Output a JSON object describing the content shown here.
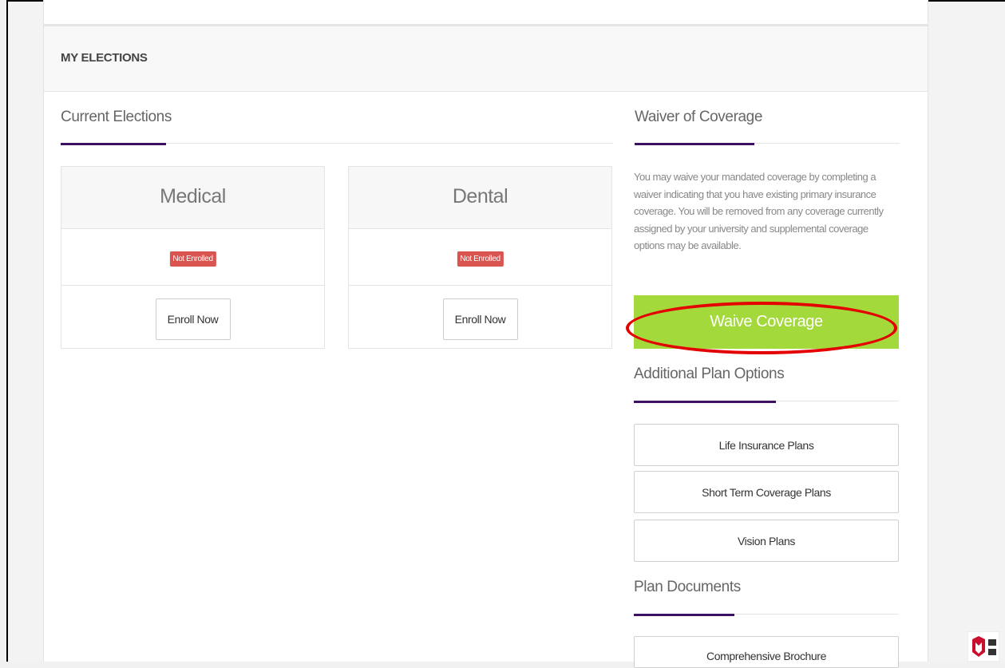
{
  "panel": {
    "title": "MY ELECTIONS"
  },
  "current_elections": {
    "title": "Current Elections",
    "cards": [
      {
        "name": "Medical",
        "status": "Not Enrolled",
        "action_label": "Enroll Now"
      },
      {
        "name": "Dental",
        "status": "Not Enrolled",
        "action_label": "Enroll Now"
      }
    ]
  },
  "waiver": {
    "title": "Waiver of Coverage",
    "description": "You may waive your mandated coverage by completing a waiver indicating that you have existing primary insurance coverage. You will be removed from any coverage currently assigned by your university and supplemental coverage options may be available.",
    "button_label": "Waive Coverage"
  },
  "additional_plans": {
    "title": "Additional Plan Options",
    "items": [
      "Life Insurance Plans",
      "Short Term Coverage Plans",
      "Vision Plans"
    ]
  },
  "plan_documents": {
    "title": "Plan Documents",
    "items": [
      "Comprehensive Brochure"
    ]
  },
  "colors": {
    "accent": "#3b0f62",
    "waive_button": "#a3d93b",
    "badge": "#d9534f",
    "highlight": "#e40000"
  },
  "icons": {
    "corner_logo": "shield-logo-icon"
  }
}
